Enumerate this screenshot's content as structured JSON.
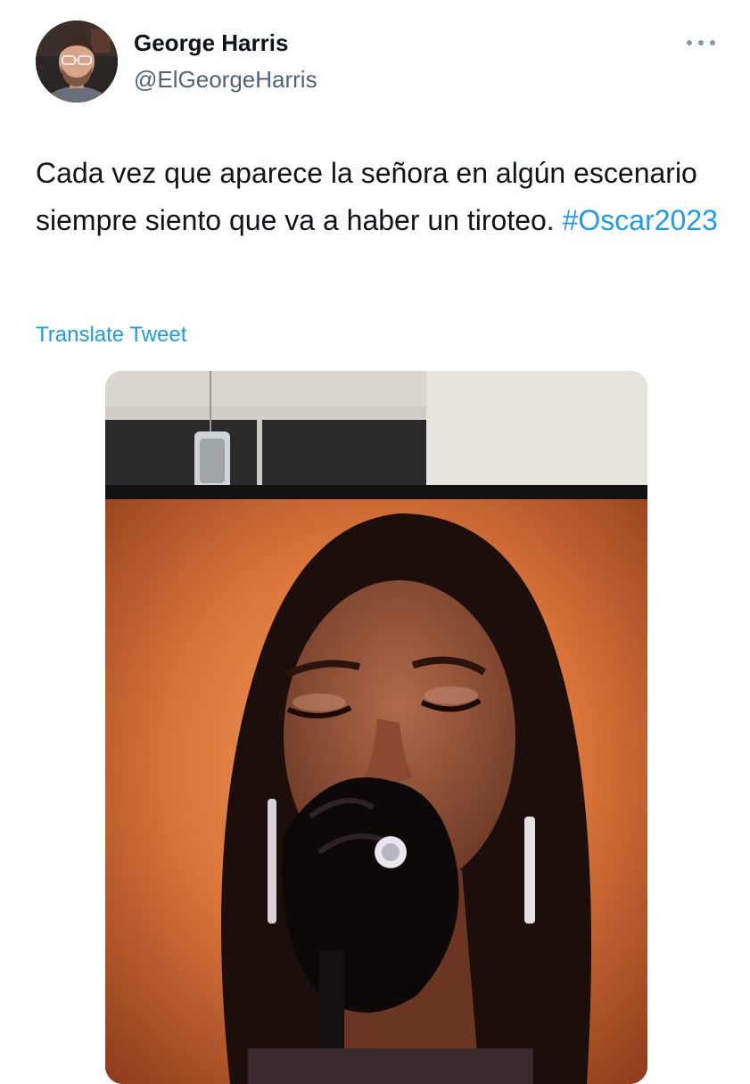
{
  "author": {
    "display_name": "George Harris",
    "handle": "@ElGeorgeHarris",
    "avatar_icon": "profile-photo"
  },
  "header": {
    "more_icon": "more-horizontal-icon"
  },
  "tweet": {
    "text_before": "Cada vez que aparece la señora en algún escenario siempre siento que va a haber un tiroteo. ",
    "hashtag": "#Oscar2023",
    "translate_label": "Translate Tweet"
  },
  "media": {
    "type": "photo"
  },
  "colors": {
    "link": "#1d9bf0",
    "text": "#0f1419",
    "secondary": "#536471"
  }
}
